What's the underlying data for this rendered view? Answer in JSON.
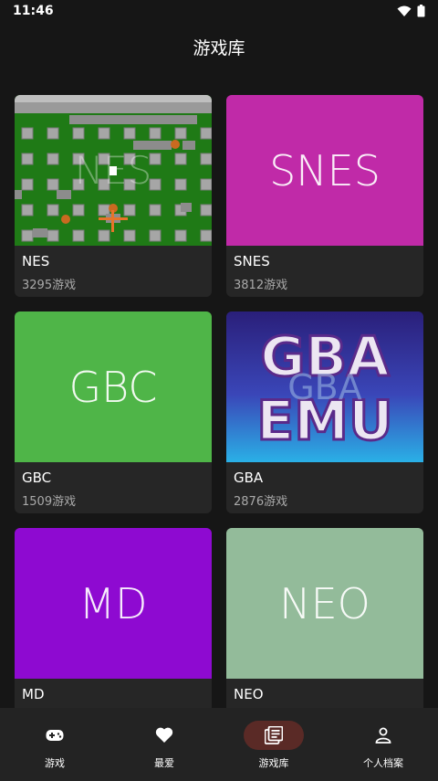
{
  "status": {
    "time": "11:46"
  },
  "header": {
    "title": "游戏库"
  },
  "cards": [
    {
      "name": "NES",
      "count": "3295游戏",
      "cover_text": "NES",
      "cover_color": "#1f7a16"
    },
    {
      "name": "SNES",
      "count": "3812游戏",
      "cover_text": "SNES",
      "cover_color": "#c02aa8"
    },
    {
      "name": "GBC",
      "count": "1509游戏",
      "cover_text": "GBC",
      "cover_color": "#4fb548"
    },
    {
      "name": "GBA",
      "count": "2876游戏",
      "cover_text": "GBA",
      "cover_color": "#1f3a9a",
      "cover_logo_line1": "GBA",
      "cover_logo_line2": "EMU"
    },
    {
      "name": "MD",
      "count": "",
      "cover_text": "MD",
      "cover_color": "#8e0ad1"
    },
    {
      "name": "NEO",
      "count": "",
      "cover_text": "NEO",
      "cover_color": "#93bb9a"
    }
  ],
  "nav": [
    {
      "label": "游戏",
      "icon": "gamepad-icon",
      "active": false
    },
    {
      "label": "最爱",
      "icon": "heart-icon",
      "active": false
    },
    {
      "label": "游戏库",
      "icon": "library-icon",
      "active": true
    },
    {
      "label": "个人档案",
      "icon": "person-icon",
      "active": false
    }
  ]
}
